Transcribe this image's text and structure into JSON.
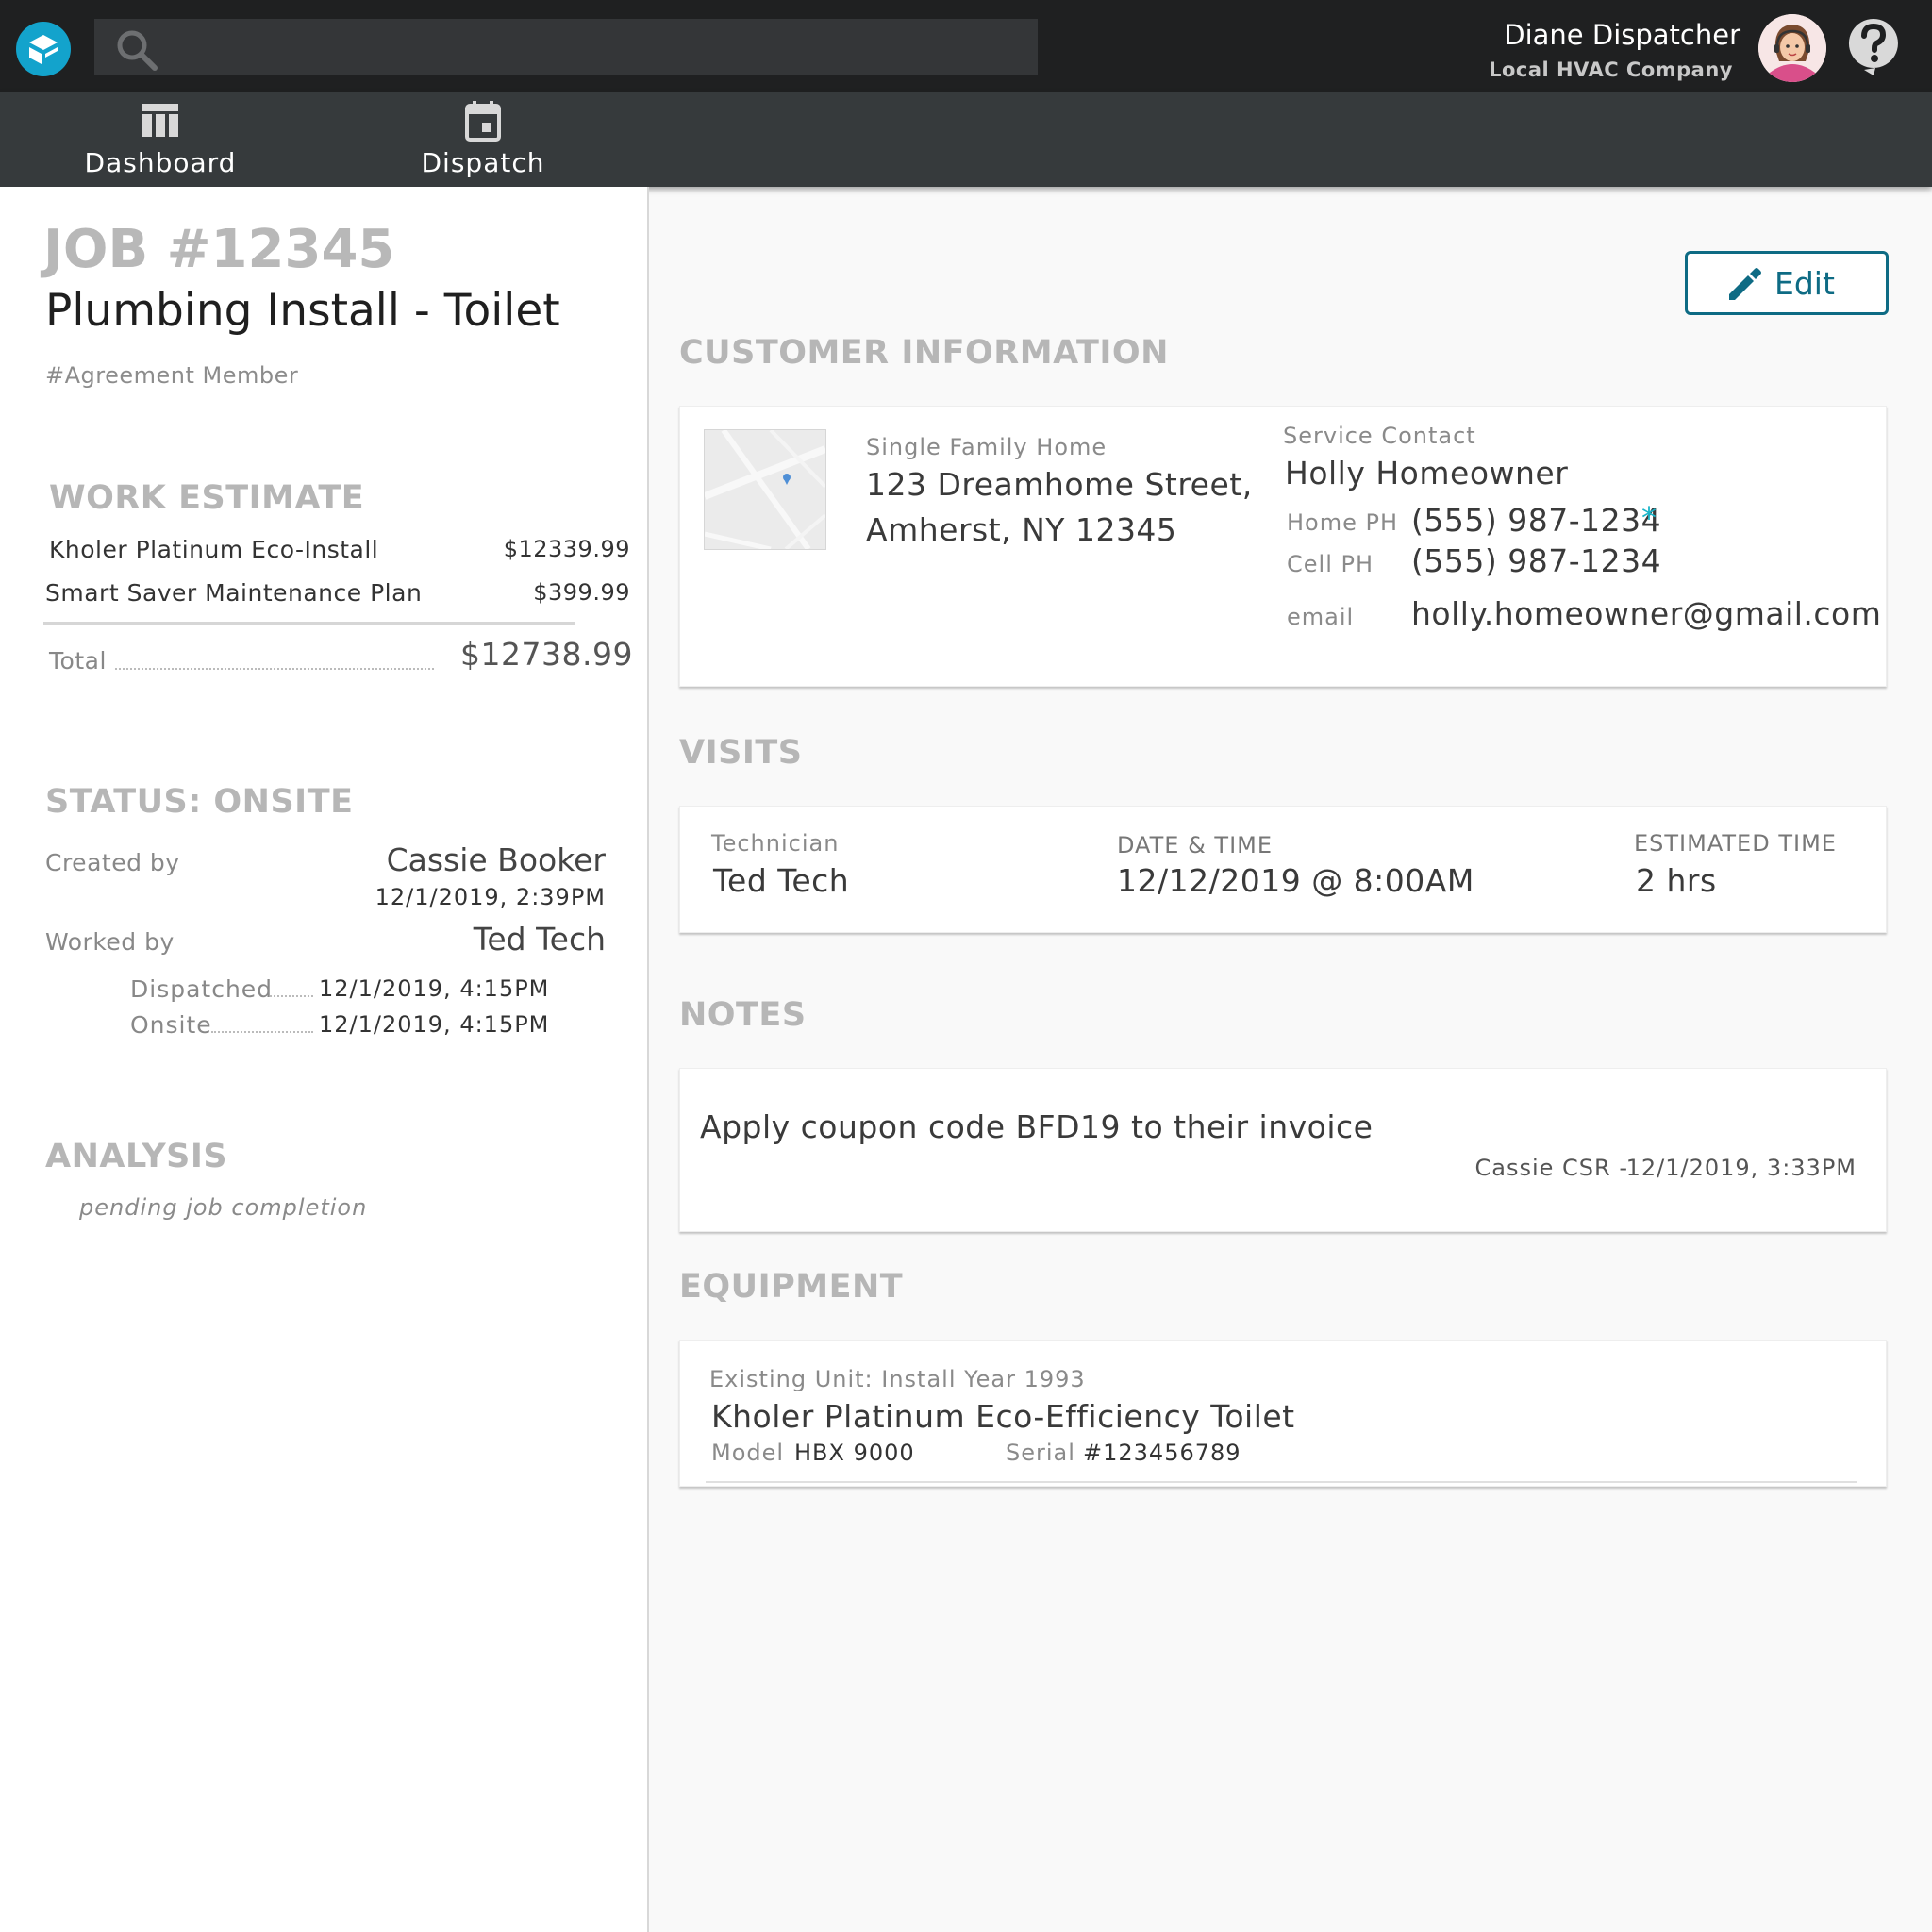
{
  "header": {
    "user_name": "Diane Dispatcher",
    "company": "Local HVAC Company"
  },
  "nav": {
    "items": [
      {
        "label": "Dashboard",
        "icon": "dashboard-icon"
      },
      {
        "label": "Dispatch",
        "icon": "calendar-icon"
      }
    ]
  },
  "job": {
    "number": "JOB #12345",
    "title": "Plumbing Install - Toilet",
    "tag": "#Agreement Member"
  },
  "work_estimate": {
    "title": "WORK ESTIMATE",
    "items": [
      {
        "name": "Kholer Platinum Eco-Install",
        "price": "$12339.99"
      },
      {
        "name": "Smart Saver Maintenance Plan",
        "price": "$399.99"
      }
    ],
    "total_label": "Total",
    "total": "$12738.99"
  },
  "status": {
    "title": "STATUS: ONSITE",
    "created_by_label": "Created by",
    "created_by": "Cassie Booker",
    "created_date": "12/1/2019, 2:39PM",
    "worked_by_label": "Worked by",
    "worked_by": "Ted Tech",
    "dispatched_label": "Dispatched",
    "dispatched_time": "12/1/2019, 4:15PM",
    "onsite_label": "Onsite",
    "onsite_time": "12/1/2019, 4:15PM"
  },
  "analysis": {
    "title": "ANALYSIS",
    "text": "pending job completion"
  },
  "edit_label": "Edit",
  "customer": {
    "title": "CUSTOMER INFORMATION",
    "home_type": "Single Family Home",
    "address_line1": "123 Dreamhome Street,",
    "address_line2": "Amherst, NY 12345",
    "contact_label": "Service Contact",
    "contact_name": "Holly Homeowner",
    "home_ph_label": "Home PH",
    "home_ph": "(555) 987-1234",
    "home_ph_marker": "*",
    "cell_ph_label": "Cell PH",
    "cell_ph": "(555) 987-1234",
    "email_label": "email",
    "email": "holly.homeowner@gmail.com"
  },
  "visits": {
    "title": "VISITS",
    "technician_label": "Technician",
    "technician": "Ted Tech",
    "datetime_label": "DATE & TIME",
    "datetime": "12/12/2019 @ 8:00AM",
    "est_time_label": "ESTIMATED TIME",
    "est_time": "2 hrs"
  },
  "notes": {
    "title": "NOTES",
    "text": "Apply coupon code BFD19 to their invoice",
    "author": "Cassie CSR -",
    "date": "12/1/2019, 3:33PM"
  },
  "equipment": {
    "title": "EQUIPMENT",
    "subtitle": "Existing Unit: Install Year 1993",
    "name": "Kholer Platinum Eco-Efficiency Toilet",
    "model_label": "Model",
    "model": "HBX 9000",
    "serial_label": "Serial",
    "serial": "#123456789"
  },
  "colors": {
    "topbar": "#1f2021",
    "navbar": "#363a3c",
    "accent": "#0e6b84",
    "logo": "#13a3cc",
    "marker": "#19b5c9"
  }
}
